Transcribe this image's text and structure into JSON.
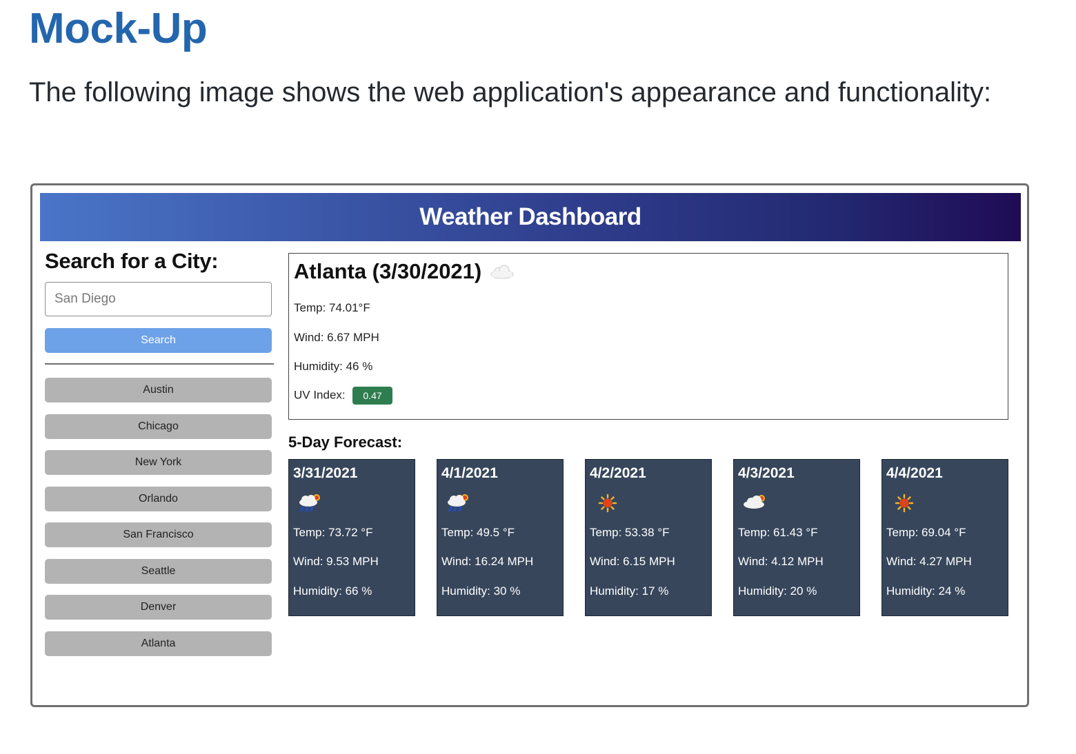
{
  "document": {
    "title": "Mock-Up",
    "intro": "The following image shows the web application's appearance and functionality:"
  },
  "app": {
    "title": "Weather Dashboard",
    "search": {
      "heading": "Search for a City:",
      "placeholder": "San Diego",
      "button_label": "Search"
    },
    "history": [
      "Austin",
      "Chicago",
      "New York",
      "Orlando",
      "San Francisco",
      "Seattle",
      "Denver",
      "Atlanta"
    ],
    "current": {
      "heading": "Atlanta (3/30/2021)",
      "icon": "cloud-icon",
      "temp": "Temp: 74.01°F",
      "wind": "Wind: 6.67 MPH",
      "humidity": "Humidity: 46 %",
      "uv_label": "UV Index:",
      "uv_value": "0.47",
      "uv_color": "#2e7d4f"
    },
    "forecast": {
      "heading": "5-Day Forecast:",
      "days": [
        {
          "date": "3/31/2021",
          "icon": "rain-sun-icon",
          "temp": "Temp: 73.72 °F",
          "wind": "Wind: 9.53 MPH",
          "humidity": "Humidity: 66 %"
        },
        {
          "date": "4/1/2021",
          "icon": "rain-sun-icon",
          "temp": "Temp: 49.5 °F",
          "wind": "Wind: 16.24 MPH",
          "humidity": "Humidity: 30 %"
        },
        {
          "date": "4/2/2021",
          "icon": "sun-icon",
          "temp": "Temp: 53.38 °F",
          "wind": "Wind: 6.15 MPH",
          "humidity": "Humidity: 17 %"
        },
        {
          "date": "4/3/2021",
          "icon": "cloud-sun-icon",
          "temp": "Temp: 61.43 °F",
          "wind": "Wind: 4.12 MPH",
          "humidity": "Humidity: 20 %"
        },
        {
          "date": "4/4/2021",
          "icon": "sun-icon",
          "temp": "Temp: 69.04 °F",
          "wind": "Wind: 4.27 MPH",
          "humidity": "Humidity: 24 %"
        }
      ]
    }
  },
  "colors": {
    "title_blue": "#2466ad",
    "header_gradient_start": "#4a75c8",
    "header_gradient_end": "#1f0b55",
    "search_button": "#6da2e8",
    "history_button": "#b3b3b3",
    "card_background": "#37465b"
  }
}
